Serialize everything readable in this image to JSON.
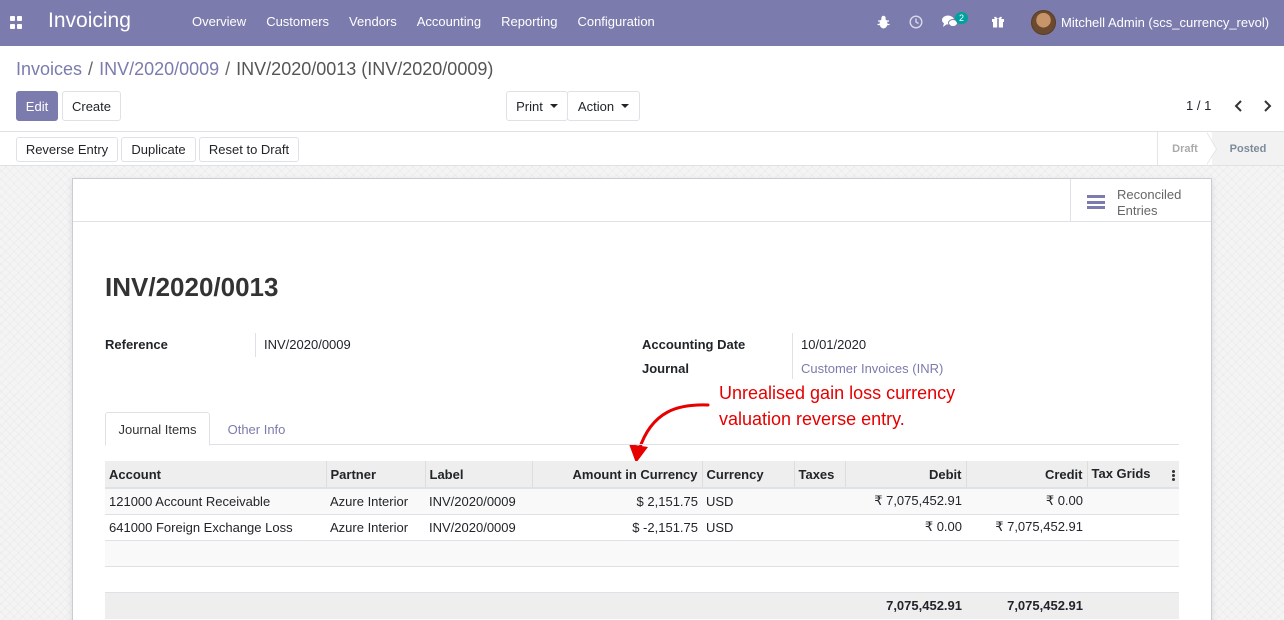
{
  "navbar": {
    "app_name": "Invoicing",
    "menu": [
      "Overview",
      "Customers",
      "Vendors",
      "Accounting",
      "Reporting",
      "Configuration"
    ],
    "messages_count": "2",
    "user_name": "Mitchell Admin (scs_currency_revol)"
  },
  "breadcrumb": {
    "root": "Invoices",
    "parent": "INV/2020/0009",
    "current": "INV/2020/0013 (INV/2020/0009)"
  },
  "toolbar": {
    "edit": "Edit",
    "create": "Create",
    "print": "Print",
    "action": "Action",
    "pager": "1 / 1"
  },
  "statusbar": {
    "reverse_entry": "Reverse Entry",
    "duplicate": "Duplicate",
    "reset_to_draft": "Reset to Draft",
    "stages": [
      "Draft",
      "Posted"
    ],
    "active_stage": "Posted"
  },
  "smart_button": {
    "line1": "Reconciled",
    "line2": "Entries"
  },
  "record": {
    "title": "INV/2020/0013",
    "reference_label": "Reference",
    "reference": "INV/2020/0009",
    "accounting_date_label": "Accounting Date",
    "accounting_date": "10/01/2020",
    "journal_label": "Journal",
    "journal": "Customer Invoices (INR)"
  },
  "annotation": {
    "line1": "Unrealised gain loss currency",
    "line2": "valuation reverse entry."
  },
  "tabs": [
    "Journal Items",
    "Other Info"
  ],
  "table": {
    "headers": [
      "Account",
      "Partner",
      "Label",
      "Amount in Currency",
      "Currency",
      "Taxes",
      "Debit",
      "Credit",
      "Tax Grids"
    ],
    "rows": [
      [
        "121000 Account Receivable",
        "Azure Interior",
        "INV/2020/0009",
        "$ 2,151.75",
        "USD",
        "",
        "₹ 7,075,452.91",
        "₹ 0.00",
        ""
      ],
      [
        "641000 Foreign Exchange Loss",
        "Azure Interior",
        "INV/2020/0009",
        "$ -2,151.75",
        "USD",
        "",
        "₹ 0.00",
        "₹ 7,075,452.91",
        ""
      ]
    ],
    "total_debit": "7,075,452.91",
    "total_credit": "7,075,452.91"
  },
  "colors": {
    "brand": "#7c7bad",
    "annotation": "#e60000",
    "badge": "#00a09d"
  }
}
